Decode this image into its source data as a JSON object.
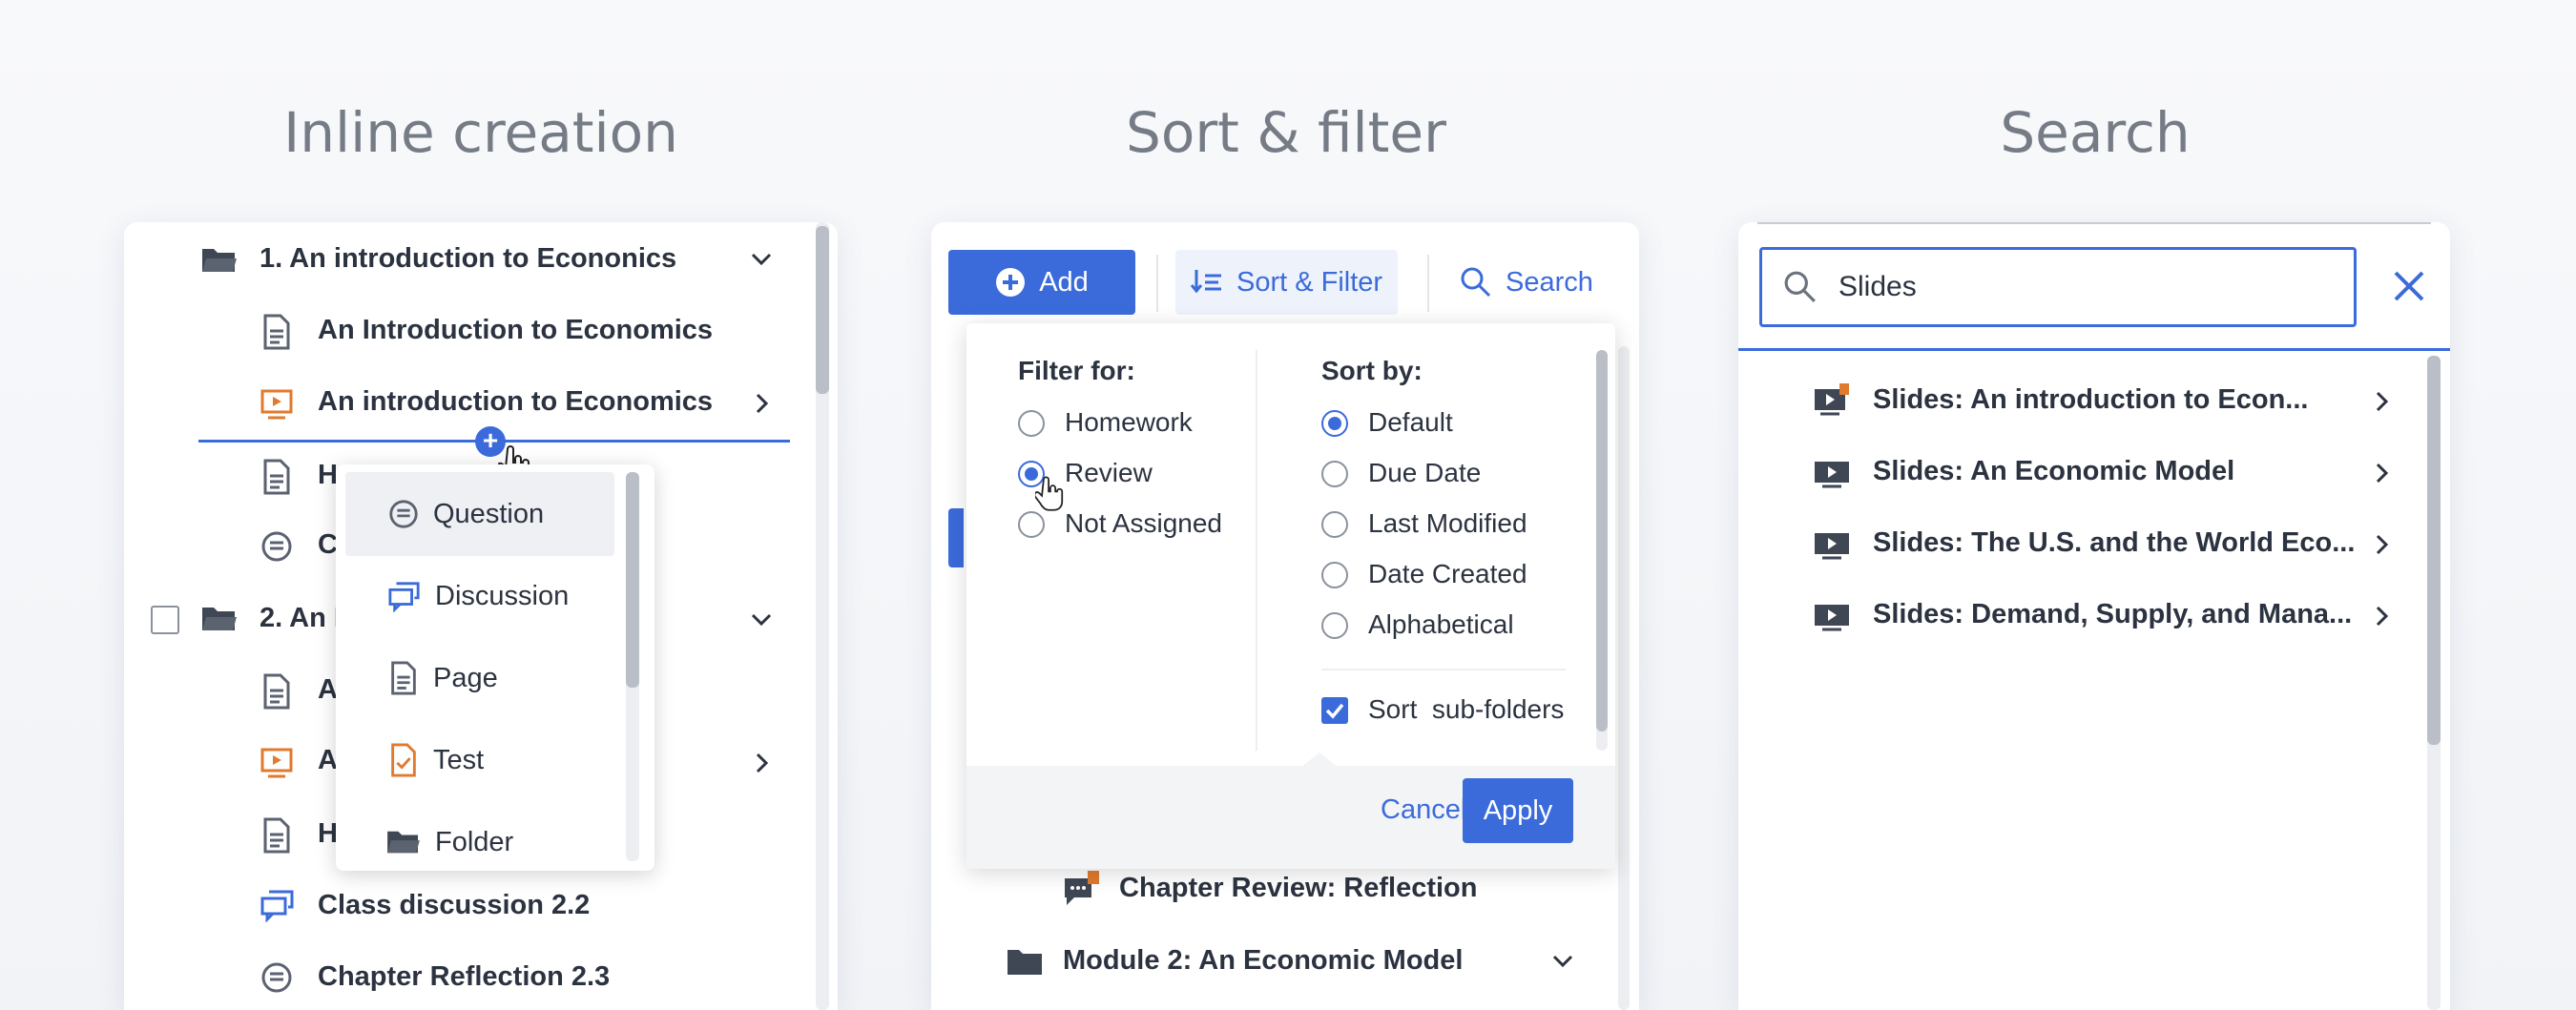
{
  "sections": {
    "inline_title": "Inline creation",
    "sort_title": "Sort & filter",
    "search_title": "Search"
  },
  "panel1": {
    "rows": [
      {
        "label": "1. An introduction to Econonics",
        "icon": "folder-open-icon"
      },
      {
        "label": "An Introduction to Economics",
        "icon": "page-icon"
      },
      {
        "label": "An introduction to Economics",
        "icon": "slides-icon"
      },
      {
        "label": "H",
        "icon": "page-icon"
      },
      {
        "label": "C",
        "icon": "question-icon"
      },
      {
        "label": "2. An E",
        "icon": "folder-open-icon"
      },
      {
        "label": "A",
        "icon": "page-icon"
      },
      {
        "label": "A",
        "icon": "slides-icon"
      },
      {
        "label": "H",
        "icon": "page-icon"
      },
      {
        "label": "Class discussion 2.2",
        "icon": "discussion-icon"
      },
      {
        "label": "Chapter Reflection 2.3",
        "icon": "question-icon"
      }
    ],
    "popup": [
      {
        "label": "Question",
        "icon": "question-icon"
      },
      {
        "label": "Discussion",
        "icon": "discussion-icon"
      },
      {
        "label": "Page",
        "icon": "page-icon"
      },
      {
        "label": "Test",
        "icon": "test-icon"
      },
      {
        "label": "Folder",
        "icon": "folder-icon"
      }
    ]
  },
  "panel2": {
    "add_label": "Add",
    "sort_filter_label": "Sort & Filter",
    "search_label": "Search",
    "filter_heading": "Filter for:",
    "filter_options": [
      "Homework",
      "Review",
      "Not Assigned"
    ],
    "filter_selected": "Review",
    "sort_heading": "Sort by:",
    "sort_options": [
      "Default",
      "Due Date",
      "Last Modified",
      "Date Created",
      "Alphabetical"
    ],
    "sort_selected": "Default",
    "subfolders_label": "Sort  sub-folders",
    "subfolders_checked": true,
    "cancel_label": "Cancel",
    "apply_label": "Apply",
    "bg_rows": [
      {
        "label": "Chapter Review: Reflection",
        "icon": "discussion-flag-icon"
      },
      {
        "label": "Module 2: An Economic Model",
        "icon": "folder-icon"
      }
    ]
  },
  "panel3": {
    "search_value": "Slides",
    "results": [
      "Slides: An introduction to Econ...",
      "Slides: An Economic Model",
      "Slides: The U.S. and the World Eco...",
      "Slides: Demand, Supply, and Mana..."
    ]
  },
  "colors": {
    "accent": "#3b6bdb",
    "text": "#2c3340",
    "orange": "#e07a2e",
    "muted_icon": "#5b6270"
  }
}
